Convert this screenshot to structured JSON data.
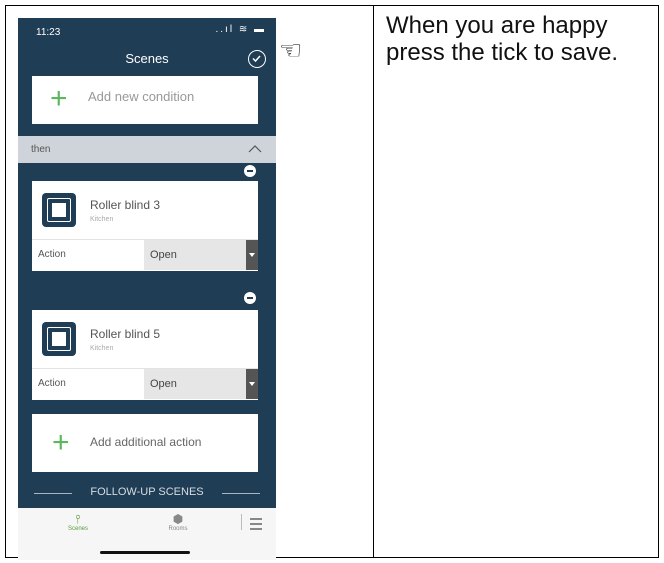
{
  "status_bar": {
    "time": "11:23",
    "icons": "..ıl ≋ ▬"
  },
  "header": {
    "title": "Scenes",
    "save_icon": "check-circle-icon"
  },
  "condition": {
    "add_label": "Add new condition"
  },
  "then_section": {
    "label": "then"
  },
  "actions": [
    {
      "device": "Roller blind 3",
      "room": "Kitchen",
      "action_label": "Action",
      "action_value": "Open"
    },
    {
      "device": "Roller blind 5",
      "room": "Kitchen",
      "action_label": "Action",
      "action_value": "Open"
    }
  ],
  "add_action": {
    "label": "Add additional action"
  },
  "follow_up": {
    "label": "FOLLOW-UP SCENES"
  },
  "tabbar": {
    "scenes": "Scenes",
    "rooms": "Rooms"
  },
  "pointer": {
    "glyph": "☜",
    "icon": "pointing-hand-icon"
  },
  "instruction": {
    "text": "When you are happy press the tick to save."
  },
  "colors": {
    "primary": "#1f3d55",
    "accent": "#5cb85c"
  }
}
